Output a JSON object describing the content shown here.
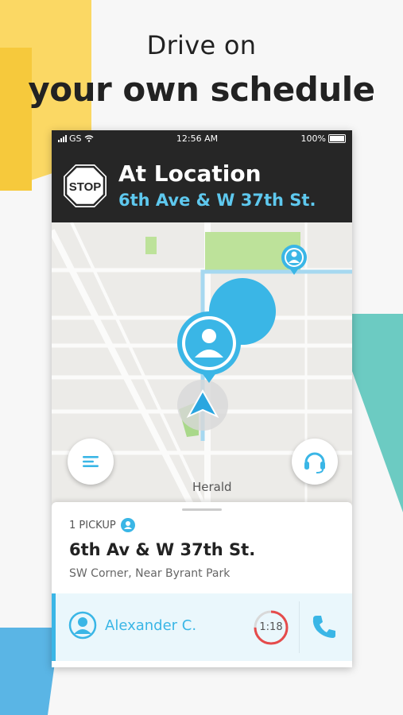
{
  "headline": {
    "line1": "Drive on",
    "line2": "your own schedule"
  },
  "statusbar": {
    "carrier": "GS",
    "time": "12:56 AM",
    "battery": "100%"
  },
  "header": {
    "stop_sign_text": "STOP",
    "title": "At Location",
    "subtitle": "6th Ave & W 37th St."
  },
  "map": {
    "place_label": "Herald",
    "icons": [
      "menu-icon",
      "headset-icon",
      "navigation-arrow-icon",
      "passenger-pin-icon"
    ]
  },
  "card": {
    "pickup_label": "1 PICKUP",
    "address": "6th Av & W 37th St.",
    "address_detail": "SW Corner, Near Byrant Park",
    "passenger_name": "Alexander C.",
    "timer": "1:18",
    "timer_progress": 0.75
  },
  "colors": {
    "accent": "#3ab6e6",
    "header_bg": "#262626",
    "timer_red": "#e54b4b"
  }
}
